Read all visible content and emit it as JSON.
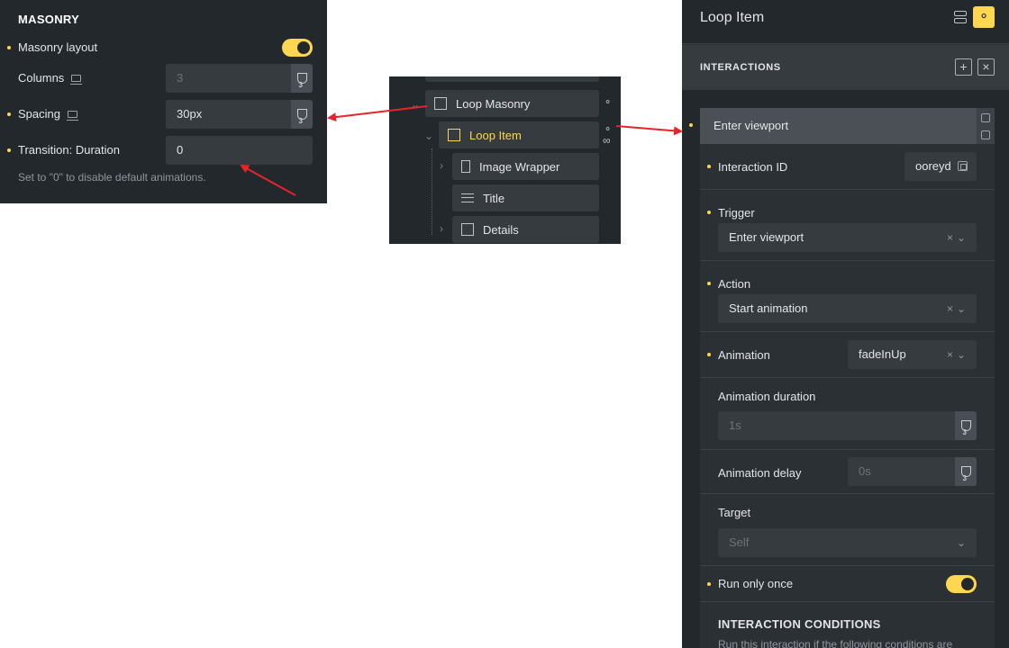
{
  "masonry": {
    "title": "MASONRY",
    "layout_label": "Masonry layout",
    "layout_on": true,
    "columns_label": "Columns",
    "columns_value": "3",
    "spacing_label": "Spacing",
    "spacing_value": "30px",
    "duration_label": "Transition: Duration",
    "duration_value": "0",
    "hint": "Set to \"0\" to disable default animations."
  },
  "structure": {
    "items": [
      {
        "label": "Loop Masonry"
      },
      {
        "label": "Loop Item"
      },
      {
        "label": "Image Wrapper"
      },
      {
        "label": "Title"
      },
      {
        "label": "Details"
      }
    ]
  },
  "interactions_panel": {
    "title": "Loop Item",
    "section_title": "INTERACTIONS",
    "card_title": "Enter viewport",
    "interaction_id_label": "Interaction ID",
    "interaction_id_value": "ooreyd",
    "trigger_label": "Trigger",
    "trigger_value": "Enter viewport",
    "action_label": "Action",
    "action_value": "Start animation",
    "animation_label": "Animation",
    "animation_value": "fadeInUp",
    "duration_label": "Animation duration",
    "duration_placeholder": "1s",
    "delay_label": "Animation delay",
    "delay_placeholder": "0s",
    "target_label": "Target",
    "target_placeholder": "Self",
    "run_once_label": "Run only once",
    "run_once_on": true,
    "conditions_title": "INTERACTION CONDITIONS",
    "conditions_text": "Run this interaction if the following conditions are"
  },
  "colors": {
    "accent": "#ffd64f",
    "panel_dark": "#23282d",
    "input_bg": "#363b40",
    "arrow": "#e8242b"
  }
}
